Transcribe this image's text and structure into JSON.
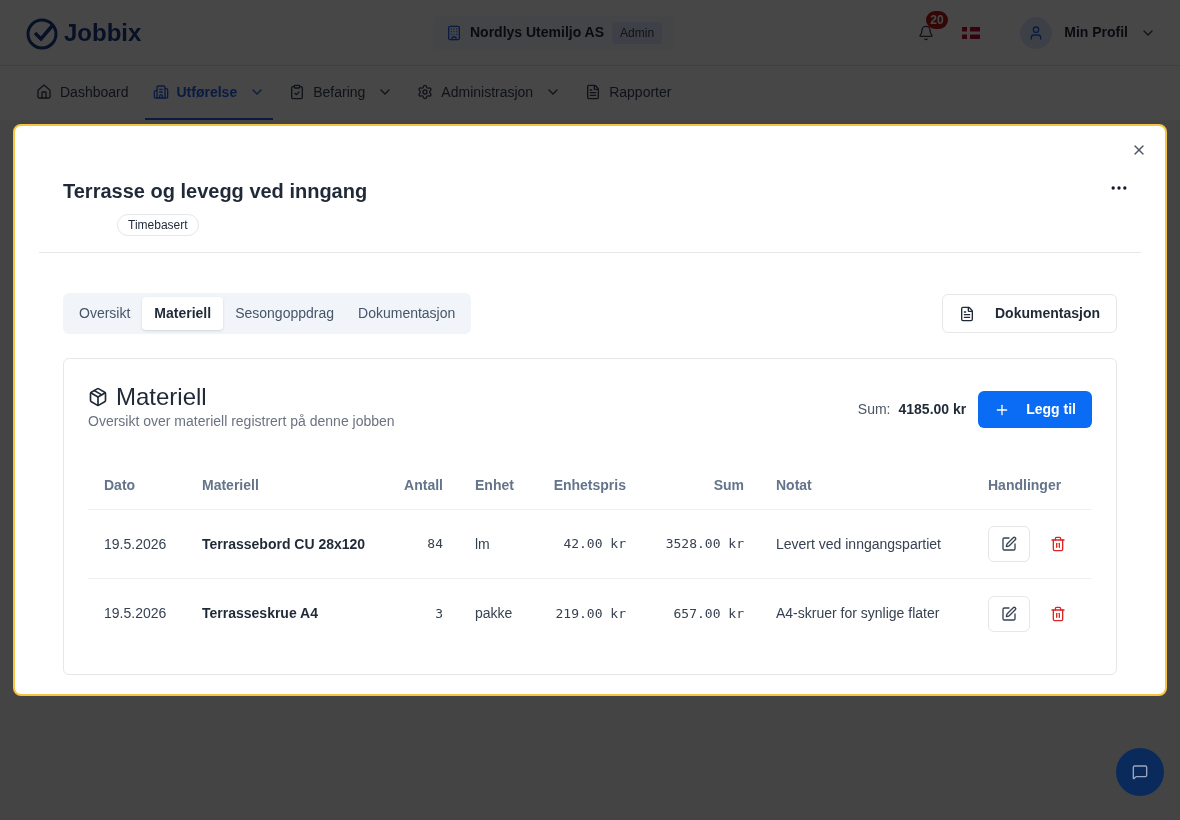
{
  "header": {
    "logo": "Jobbix",
    "company": "Nordlys Utemiljo AS",
    "role": "Admin",
    "notifications": "20",
    "profile": "Min Profil"
  },
  "nav": [
    {
      "label": "Dashboard",
      "selected": false,
      "has_menu": false
    },
    {
      "label": "Utførelse",
      "selected": true,
      "has_menu": true
    },
    {
      "label": "Befaring",
      "selected": false,
      "has_menu": true
    },
    {
      "label": "Administrasjon",
      "selected": false,
      "has_menu": true
    },
    {
      "label": "Rapporter",
      "selected": false,
      "has_menu": false
    }
  ],
  "modal": {
    "title": "Terrasse og levegg ved inngang",
    "badge": "Timebasert",
    "tabs": [
      {
        "label": "Oversikt",
        "selected": false
      },
      {
        "label": "Materiell",
        "selected": true
      },
      {
        "label": "Sesongoppdrag",
        "selected": false
      },
      {
        "label": "Dokumentasjon",
        "selected": false
      }
    ],
    "doc_button": "Dokumentasjon",
    "section": {
      "title": "Materiell",
      "subtitle": "Oversikt over materiell registrert på denne jobben",
      "sum_label": "Sum:",
      "sum_value": "4185.00 kr",
      "add_button": "Legg til",
      "columns": [
        {
          "label": "Dato",
          "kind": "date"
        },
        {
          "label": "Materiell",
          "kind": "name"
        },
        {
          "label": "Antall",
          "kind": "number"
        },
        {
          "label": "Enhet",
          "kind": "text"
        },
        {
          "label": "Enhetspris",
          "kind": "number"
        },
        {
          "label": "Sum",
          "kind": "number"
        },
        {
          "label": "Notat",
          "kind": "text"
        },
        {
          "label": "Handlinger",
          "kind": "actions"
        }
      ],
      "rows": [
        {
          "cells": [
            "19.5.2026",
            "Terrassebord CU 28x120",
            "84",
            "lm",
            "42.00 kr",
            "3528.00 kr",
            "Levert ved inngangspartiet"
          ]
        },
        {
          "cells": [
            "19.5.2026",
            "Terrasseskrue A4",
            "3",
            "pakke",
            "219.00 kr",
            "657.00 kr",
            "A4-skruer for synlige flater"
          ]
        }
      ]
    }
  }
}
